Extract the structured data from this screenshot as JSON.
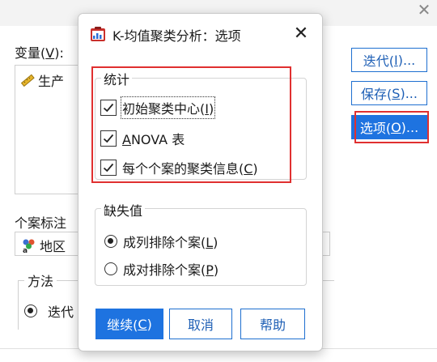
{
  "background": {
    "variables_label": "变量(",
    "variables_mnemonic": "V",
    "variables_suffix": "):",
    "variable_item": "生产",
    "case_label_label": "个案标注",
    "case_label_item": "地区",
    "method_label": "方法",
    "method_option": "迭代",
    "buttons": {
      "iterate_prefix": "迭代(",
      "iterate_mnemonic": "I",
      "iterate_suffix": ")...",
      "save_prefix": "保存(",
      "save_mnemonic": "S",
      "save_suffix": ")...",
      "options_prefix": "选项(",
      "options_mnemonic": "O",
      "options_suffix": ")..."
    },
    "close_glyph": "✕"
  },
  "dialog": {
    "title": "K-均值聚类分析：选项",
    "close_glyph": "✕",
    "statistics": {
      "legend": "统计",
      "initial_centers_prefix": "初始聚类中心(",
      "initial_centers_mnemonic": "I",
      "initial_centers_suffix": ")",
      "anova_mnemonic": "A",
      "anova_rest": "NOVA 表",
      "cluster_info_prefix": "每个个案的聚类信息(",
      "cluster_info_mnemonic": "C",
      "cluster_info_suffix": ")"
    },
    "missing": {
      "legend": "缺失值",
      "listwise_prefix": "成列排除个案(",
      "listwise_mnemonic": "L",
      "listwise_suffix": ")",
      "pairwise_prefix": "成对排除个案(",
      "pairwise_mnemonic": "P",
      "pairwise_suffix": ")"
    },
    "buttons": {
      "continue_prefix": "继续(",
      "continue_mnemonic": "C",
      "continue_suffix": ")",
      "cancel": "取消",
      "help": "帮助"
    }
  },
  "colors": {
    "accent": "#1e73e0",
    "highlight_red": "#e03030"
  }
}
